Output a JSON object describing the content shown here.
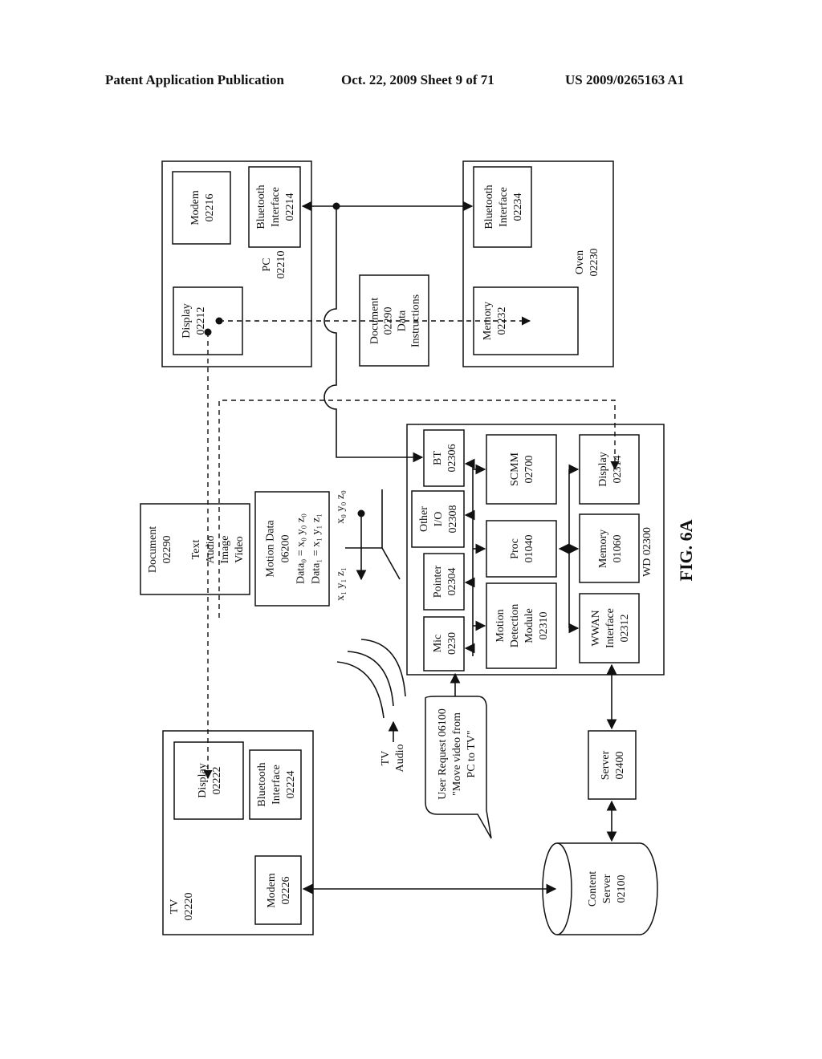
{
  "header": {
    "publication": "Patent Application Publication",
    "date_sheet": "Oct. 22, 2009   Sheet 9 of 71",
    "number": "US 2009/0265163 A1"
  },
  "figure_label": "FIG. 6A",
  "pc": {
    "title": [
      "PC",
      "02210"
    ],
    "modem": [
      "Modem",
      "02216"
    ],
    "bluetooth": [
      "Bluetooth",
      "Interface",
      "02214"
    ],
    "display": [
      "Display",
      "02212"
    ]
  },
  "oven": {
    "title": [
      "Oven",
      "02230"
    ],
    "bluetooth": [
      "Bluetooth",
      "Interface",
      "02234"
    ],
    "memory": [
      "Memory",
      "02232"
    ]
  },
  "doc_transfer": [
    "Document",
    "02290",
    "Data",
    "Instructions"
  ],
  "document": [
    "Document",
    "02290",
    "",
    "Text",
    "Audio",
    "Image",
    "Video"
  ],
  "motion_data": [
    "Motion Data",
    "06200",
    "Data₀ = x₀ y₀ z₀",
    "Data₁ = x₁ y₁ z₁"
  ],
  "axis_labels": {
    "start": "x₀  y₀  z₀",
    "end": "x₁ y₁ z₁"
  },
  "wd": {
    "title": "WD 02300",
    "bt": [
      "BT",
      "02306"
    ],
    "other_io": [
      "Other",
      "I/O",
      "02308"
    ],
    "pointer": [
      "Pointer",
      "02304"
    ],
    "mic": [
      "Mic",
      "0230"
    ],
    "scmm": [
      "SCMM",
      "02700"
    ],
    "proc": [
      "Proc",
      "01040"
    ],
    "motion_module": [
      "Motion",
      "Detection",
      "Module",
      "02310"
    ],
    "display": [
      "Display",
      "02314"
    ],
    "memory": [
      "Memory",
      "01060"
    ],
    "wwan": [
      "WWAN",
      "Interface",
      "02312"
    ]
  },
  "tv_audio": [
    "TV",
    "Audio"
  ],
  "user_request": [
    "User Request 06100",
    "\"Move video from",
    "PC to TV\""
  ],
  "tv": {
    "title": [
      "TV",
      "02220"
    ],
    "display": [
      "Display",
      "02222"
    ],
    "bluetooth": [
      "Bluetooth",
      "Interface",
      "02224"
    ],
    "modem": [
      "Modem",
      "02226"
    ]
  },
  "server": [
    "Server",
    "02400"
  ],
  "content_server": [
    "Content",
    "Server",
    "02100"
  ]
}
